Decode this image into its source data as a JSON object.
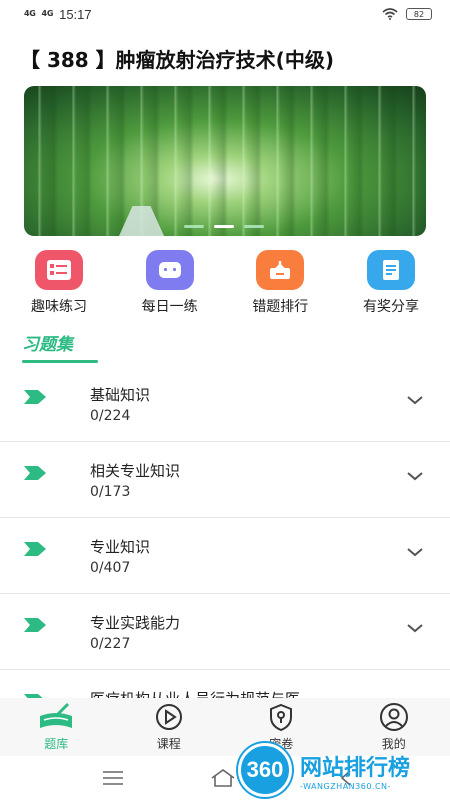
{
  "status_bar": {
    "signal_1": "4G",
    "signal_2": "4G",
    "time": "15:17",
    "battery": "82"
  },
  "header": {
    "title": "【 388 】肿瘤放射治疗技术(中级)"
  },
  "banner": {
    "slide_count": 3,
    "active_slide": 2
  },
  "quick_nav": [
    {
      "label": "趣味练习",
      "icon": "quiz-card-icon",
      "color": "#f0566a"
    },
    {
      "label": "每日一练",
      "icon": "robot-face-icon",
      "color": "#7f7cf0"
    },
    {
      "label": "错题排行",
      "icon": "share-box-icon",
      "color": "#f97d3c"
    },
    {
      "label": "有奖分享",
      "icon": "notebook-icon",
      "color": "#38a8ec"
    }
  ],
  "section": {
    "tab_label": "习题集",
    "accent": "#2dbb83"
  },
  "question_sets": [
    {
      "title": "基础知识",
      "count": "0/224"
    },
    {
      "title": "相关专业知识",
      "count": "0/173"
    },
    {
      "title": "专业知识",
      "count": "0/407"
    },
    {
      "title": "专业实践能力",
      "count": "0/227"
    },
    {
      "title": "医疗机构从业人员行为规范与医",
      "count": ""
    }
  ],
  "tabbar": [
    {
      "label": "题库",
      "icon": "book-pen-icon",
      "active": true
    },
    {
      "label": "课程",
      "icon": "play-circle-icon",
      "active": false
    },
    {
      "label": "密卷",
      "icon": "shield-lock-icon",
      "active": false
    },
    {
      "label": "我的",
      "icon": "user-icon",
      "active": false
    }
  ],
  "watermark": {
    "logo_text": "360",
    "cn": "网站排行榜",
    "en": "-WANGZHAN360.CN-"
  }
}
